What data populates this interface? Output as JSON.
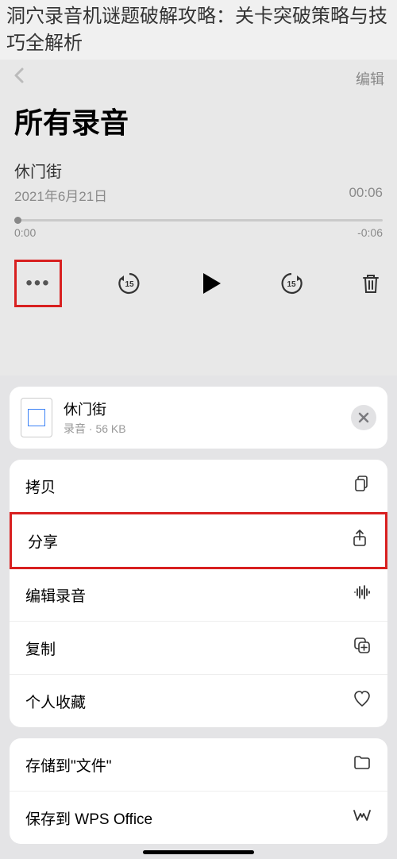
{
  "article": {
    "title": "洞穴录音机谜题破解攻略：关卡突破策略与技巧全解析"
  },
  "nav": {
    "edit": "编辑"
  },
  "page": {
    "title": "所有录音"
  },
  "recording": {
    "name": "休门街",
    "date": "2021年6月21日",
    "duration": "00:06"
  },
  "scrubber": {
    "current": "0:00",
    "remaining": "-0:06"
  },
  "controls": {
    "more": "•••"
  },
  "sheet": {
    "file": {
      "name": "休门街",
      "type": "录音",
      "size": "56 KB"
    },
    "actions": {
      "copy": "拷贝",
      "share": "分享",
      "edit_recording": "编辑录音",
      "duplicate": "复制",
      "favorite": "个人收藏",
      "save_to_files": "存储到\"文件\"",
      "save_to_wps": "保存到 WPS Office"
    }
  }
}
